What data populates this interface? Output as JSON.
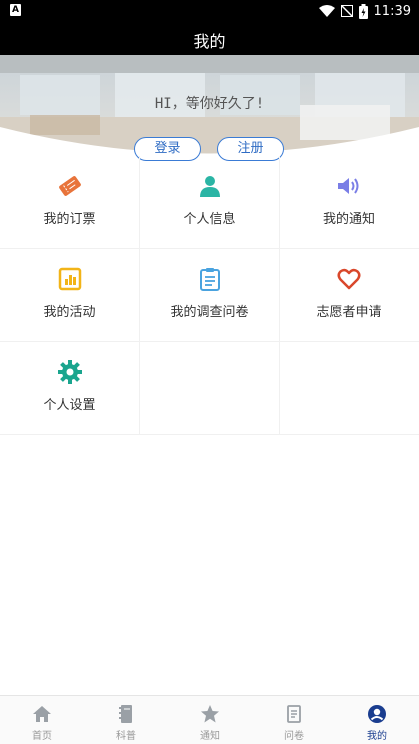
{
  "status_bar": {
    "notification_letter": "A",
    "time": "11:39"
  },
  "header": {
    "title": "我的",
    "greeting": "HI，等你好久了!",
    "login_label": "登录",
    "register_label": "注册"
  },
  "menu": {
    "items": [
      {
        "label": "我的订票",
        "icon": "ticket-icon",
        "color": "#e8743b"
      },
      {
        "label": "个人信息",
        "icon": "person-icon",
        "color": "#2bb5a5"
      },
      {
        "label": "我的通知",
        "icon": "speaker-icon",
        "color": "#7a7ee6"
      },
      {
        "label": "我的活动",
        "icon": "bar-chart-icon",
        "color": "#f2b418"
      },
      {
        "label": "我的调查问卷",
        "icon": "clipboard-icon",
        "color": "#4aa3df"
      },
      {
        "label": "志愿者申请",
        "icon": "heart-icon",
        "color": "#d9472b"
      },
      {
        "label": "个人设置",
        "icon": "gear-icon",
        "color": "#1aa58e"
      }
    ]
  },
  "tabs": [
    {
      "label": "首页",
      "icon": "home-icon"
    },
    {
      "label": "科普",
      "icon": "book-icon"
    },
    {
      "label": "通知",
      "icon": "star-icon"
    },
    {
      "label": "问卷",
      "icon": "document-icon"
    },
    {
      "label": "我的",
      "icon": "profile-icon",
      "active": true
    }
  ],
  "colors": {
    "accent": "#1a3d8f",
    "button_border": "#3a7bd5"
  }
}
